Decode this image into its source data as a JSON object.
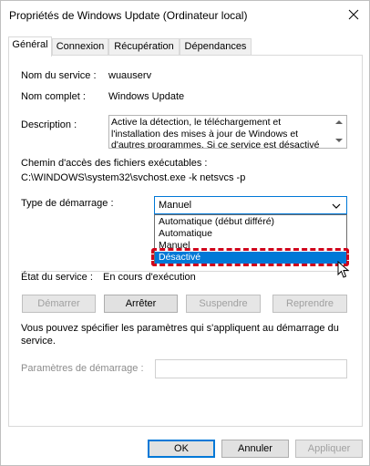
{
  "window": {
    "title": "Propriétés de Windows Update (Ordinateur local)",
    "close_label": "✕"
  },
  "tabs": [
    {
      "label": "Général",
      "active": true
    },
    {
      "label": "Connexion",
      "active": false
    },
    {
      "label": "Récupération",
      "active": false
    },
    {
      "label": "Dépendances",
      "active": false
    }
  ],
  "general": {
    "service_name_label": "Nom du service :",
    "service_name_value": "wuauserv",
    "display_name_label": "Nom complet :",
    "display_name_value": "Windows Update",
    "description_label": "Description :",
    "description_value": "Active la détection, le téléchargement et l'installation des mises à jour de Windows et d'autres programmes. Si ce service est désactivé",
    "path_label": "Chemin d'accès des fichiers exécutables :",
    "path_value": "C:\\WINDOWS\\system32\\svchost.exe -k netsvcs -p",
    "startup_type_label": "Type de démarrage :",
    "startup_type_value": "Manuel",
    "startup_options": [
      {
        "label": "Automatique (début différé)",
        "selected": false
      },
      {
        "label": "Automatique",
        "selected": false
      },
      {
        "label": "Manuel",
        "selected": false
      },
      {
        "label": "Désactivé",
        "selected": true
      }
    ],
    "status_label": "État du service :",
    "status_value": "En cours d'exécution",
    "buttons": {
      "start": "Démarrer",
      "stop": "Arrêter",
      "pause": "Suspendre",
      "resume": "Reprendre"
    },
    "info_text": "Vous pouvez spécifier les paramètres qui s'appliquent au démarrage du service.",
    "params_label": "Paramètres de démarrage :",
    "params_value": ""
  },
  "footer": {
    "ok": "OK",
    "cancel": "Annuler",
    "apply": "Appliquer"
  },
  "colors": {
    "accent": "#0078d7",
    "highlight": "#d0021b"
  }
}
